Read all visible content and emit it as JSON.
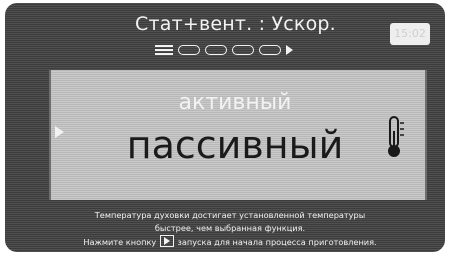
{
  "header": {
    "title": "Стат+вент. : Ускор.",
    "time_badge": "15:02"
  },
  "step_indicator": {
    "icons": [
      "menu-icon",
      "step-box",
      "step-box",
      "step-box",
      "step-box",
      "play-arrow-icon"
    ]
  },
  "modes": {
    "active": "активный",
    "passive": "пассивный"
  },
  "info": {
    "line1": "Температура духовки достигает установленной температуры",
    "line2": "быстрее, чем выбранная функция.",
    "line3_before": "Нажмите кнопку",
    "line3_after": "запуска для начала процесса приготовления."
  },
  "colors": {
    "background": "#3c3c3c",
    "frame": "#b8b8b8",
    "text_light": "#f2f2f2",
    "text_dark": "#1a1a1a"
  }
}
